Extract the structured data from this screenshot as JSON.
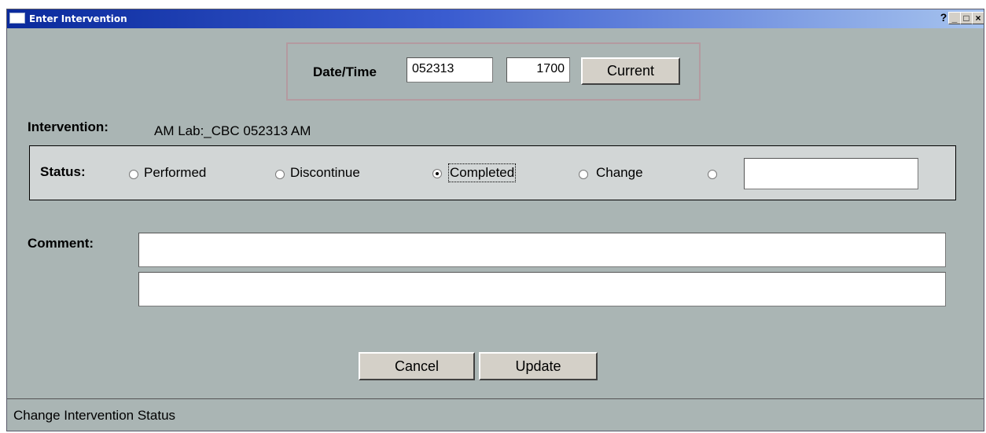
{
  "window": {
    "title": "Enter Intervention",
    "help": "?",
    "minimize": "_",
    "maximize": "□",
    "close": "×"
  },
  "datetime": {
    "label": "Date/Time",
    "date": "052313",
    "time": "1700",
    "current_button": "Current"
  },
  "intervention": {
    "label": "Intervention:",
    "value": "AM Lab:_CBC 052313 AM"
  },
  "status": {
    "label": "Status:",
    "options": [
      {
        "label": "Performed",
        "selected": false
      },
      {
        "label": "Discontinue",
        "selected": false
      },
      {
        "label": "Completed",
        "selected": true
      },
      {
        "label": "Change",
        "selected": false
      },
      {
        "label": "",
        "selected": false
      }
    ],
    "other_value": ""
  },
  "comment": {
    "label": "Comment:",
    "line1": "",
    "line2": ""
  },
  "buttons": {
    "cancel": "Cancel",
    "update": "Update"
  },
  "statusbar": {
    "text": "Change Intervention Status"
  }
}
